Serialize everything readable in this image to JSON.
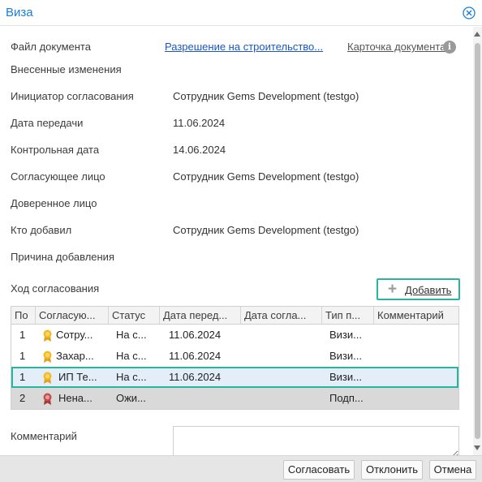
{
  "window": {
    "title": "Виза"
  },
  "fields": {
    "file_label": "Файл документа",
    "file_link": "Разрешение на строительство...",
    "card_link": "Карточка документа",
    "changes_label": "Внесенные изменения",
    "initiator_label": "Инициатор согласования",
    "initiator_value": "Сотрудник Gems Development (testgo)",
    "transfer_date_label": "Дата передачи",
    "transfer_date_value": "11.06.2024",
    "control_date_label": "Контрольная дата",
    "control_date_value": "14.06.2024",
    "approver_label": "Согласующее лицо",
    "approver_value": "Сотрудник Gems Development (testgo)",
    "trusted_label": "Доверенное лицо",
    "added_by_label": "Кто добавил",
    "added_by_value": "Сотрудник Gems Development (testgo)",
    "reason_label": "Причина добавления"
  },
  "progress": {
    "title": "Ход согласования",
    "add_label": "Добавить"
  },
  "grid": {
    "columns": [
      "По",
      "Согласую...",
      "Статус",
      "Дата перед...",
      "Дата согла...",
      "Тип п...",
      "Комментарий"
    ],
    "rows": [
      {
        "num": "1",
        "person": "Сотру...",
        "status": "На с...",
        "date_sent": "11.06.2024",
        "date_approved": "",
        "type": "Визи...",
        "comment": "",
        "medal": "gold"
      },
      {
        "num": "1",
        "person": "Захар...",
        "status": "На с...",
        "date_sent": "11.06.2024",
        "date_approved": "",
        "type": "Визи...",
        "comment": "",
        "medal": "gold"
      },
      {
        "num": "1",
        "person": "ИП Те...",
        "status": "На с...",
        "date_sent": "11.06.2024",
        "date_approved": "",
        "type": "Визи...",
        "comment": "",
        "medal": "gold"
      },
      {
        "num": "2",
        "person": "Нена...",
        "status": "Ожи...",
        "date_sent": "",
        "date_approved": "",
        "type": "Подп...",
        "comment": "",
        "medal": "red"
      }
    ]
  },
  "comment": {
    "label": "Комментарий",
    "value": ""
  },
  "footer": {
    "approve_label": "Согласовать",
    "reject_label": "Отклонить",
    "cancel_label": "Отмена"
  },
  "colors": {
    "accent": "#2bb5a0",
    "title": "#1a7fd4",
    "link": "#1a56c4",
    "selected_row": "#e3eef9"
  }
}
